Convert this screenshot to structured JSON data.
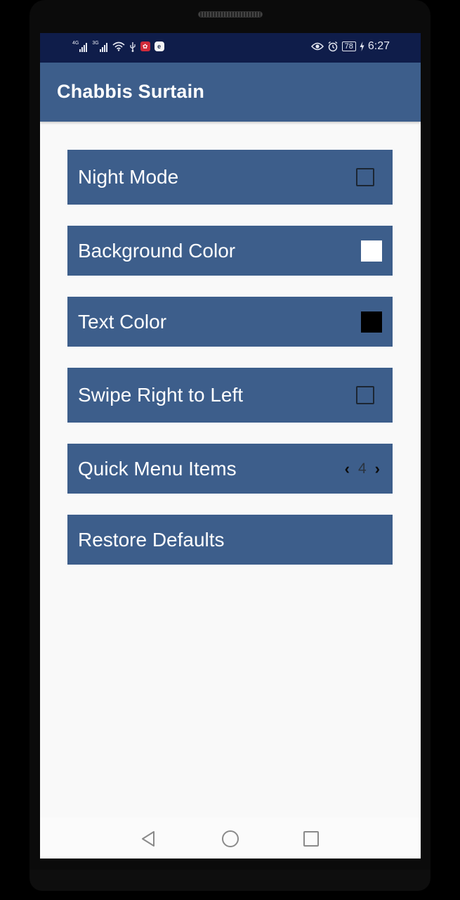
{
  "status_bar": {
    "network_1": "4G",
    "network_2": "3G",
    "battery": "78",
    "time": "6:27",
    "icons": [
      "signal-icon",
      "signal-icon",
      "wifi-icon",
      "usb-icon",
      "huawei-app-icon",
      "app-icon",
      "eye-comfort-icon",
      "alarm-icon",
      "battery-icon",
      "charging-icon"
    ]
  },
  "app_bar": {
    "title": "Chabbis Surtain"
  },
  "settings": {
    "night_mode": {
      "label": "Night Mode",
      "checked": false
    },
    "background_color": {
      "label": "Background Color",
      "color": "#ffffff"
    },
    "text_color": {
      "label": "Text Color",
      "color": "#000000"
    },
    "swipe": {
      "label": "Swipe Right to Left",
      "checked": false
    },
    "quick_menu": {
      "label": "Quick Menu Items",
      "value": "4"
    },
    "restore": {
      "label": "Restore Defaults"
    }
  },
  "colors": {
    "status_bar": "#0f1d4a",
    "accent": "#3d5e8b",
    "background": "#f9f9f9"
  },
  "nav_bar": {
    "icons": [
      "back-icon",
      "home-icon",
      "recents-icon"
    ]
  }
}
